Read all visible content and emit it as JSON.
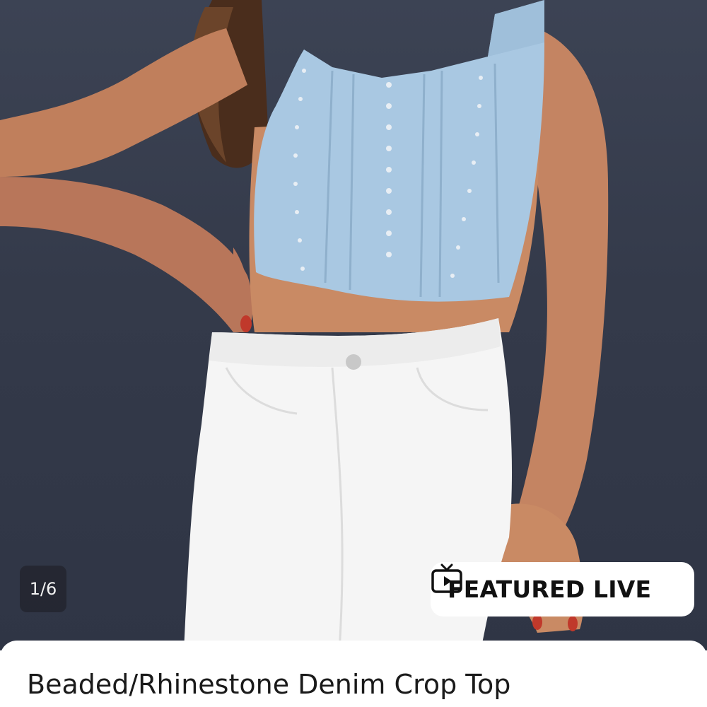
{
  "gallery": {
    "image_alt": "Woman wearing a light-wash beaded denim crop top with white high-waisted jeans",
    "counter": "1/6"
  },
  "badge": {
    "label": "FEATURED LIVE",
    "icon": "tv-play-icon"
  },
  "product": {
    "title": "Beaded/Rhinestone Denim Crop Top"
  },
  "colors": {
    "backdrop": "#343a4a",
    "denim": "#a9c8e2",
    "jeans": "#f5f5f5",
    "skin": "#c98a64"
  }
}
